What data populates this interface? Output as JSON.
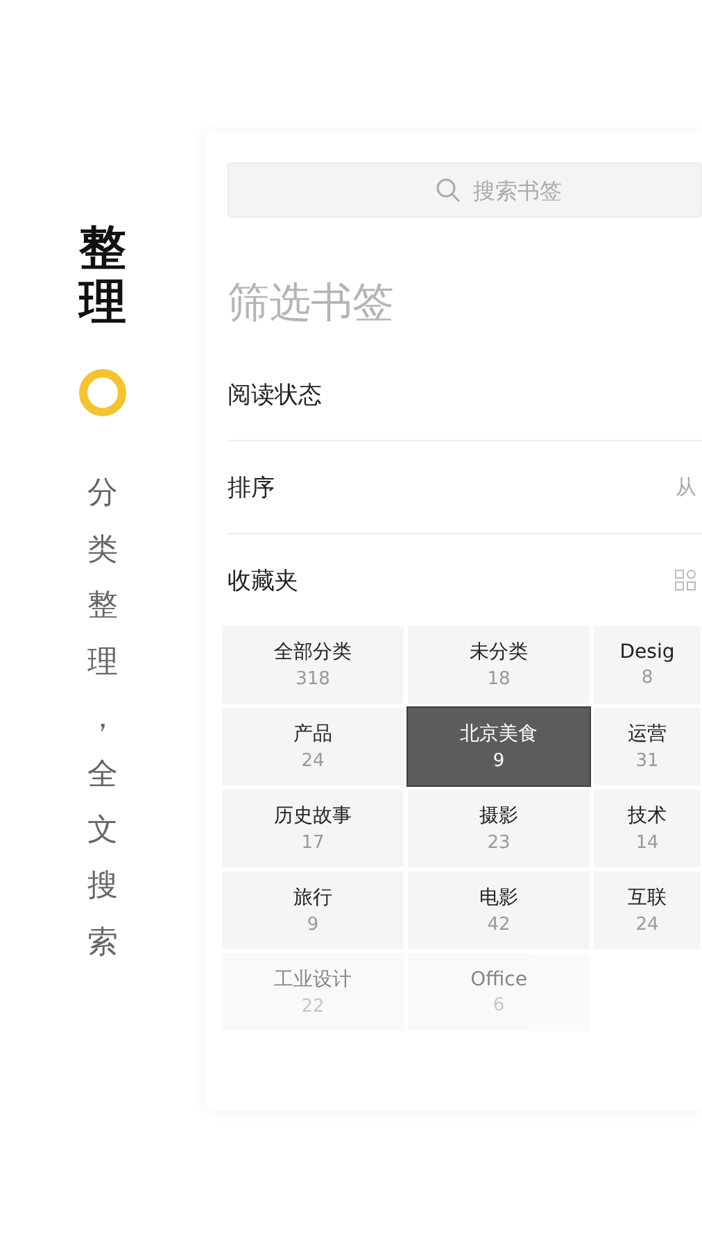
{
  "side": {
    "title": "整理",
    "subtitle": "分类整理，全文搜索"
  },
  "search": {
    "placeholder": "搜索书签"
  },
  "heading": "筛选书签",
  "filters": [
    {
      "label": "阅读状态"
    },
    {
      "label": "排序",
      "value": "从"
    },
    {
      "label": "收藏夹",
      "kind": "grid"
    }
  ],
  "folders": [
    {
      "name": "全部分类",
      "count": "318",
      "selected": false
    },
    {
      "name": "未分类",
      "count": "18",
      "selected": false
    },
    {
      "name": "Desig",
      "count": "8",
      "selected": false
    },
    {
      "name": "产品",
      "count": "24",
      "selected": false
    },
    {
      "name": "北京美食",
      "count": "9",
      "selected": true
    },
    {
      "name": "运营",
      "count": "31",
      "selected": false
    },
    {
      "name": "历史故事",
      "count": "17",
      "selected": false
    },
    {
      "name": "摄影",
      "count": "23",
      "selected": false
    },
    {
      "name": "技术",
      "count": "14",
      "selected": false
    },
    {
      "name": "旅行",
      "count": "9",
      "selected": false
    },
    {
      "name": "电影",
      "count": "42",
      "selected": false
    },
    {
      "name": "互联",
      "count": "24",
      "selected": false
    },
    {
      "name": "工业设计",
      "count": "22",
      "selected": false
    },
    {
      "name": "Office",
      "count": "6",
      "selected": false
    }
  ]
}
